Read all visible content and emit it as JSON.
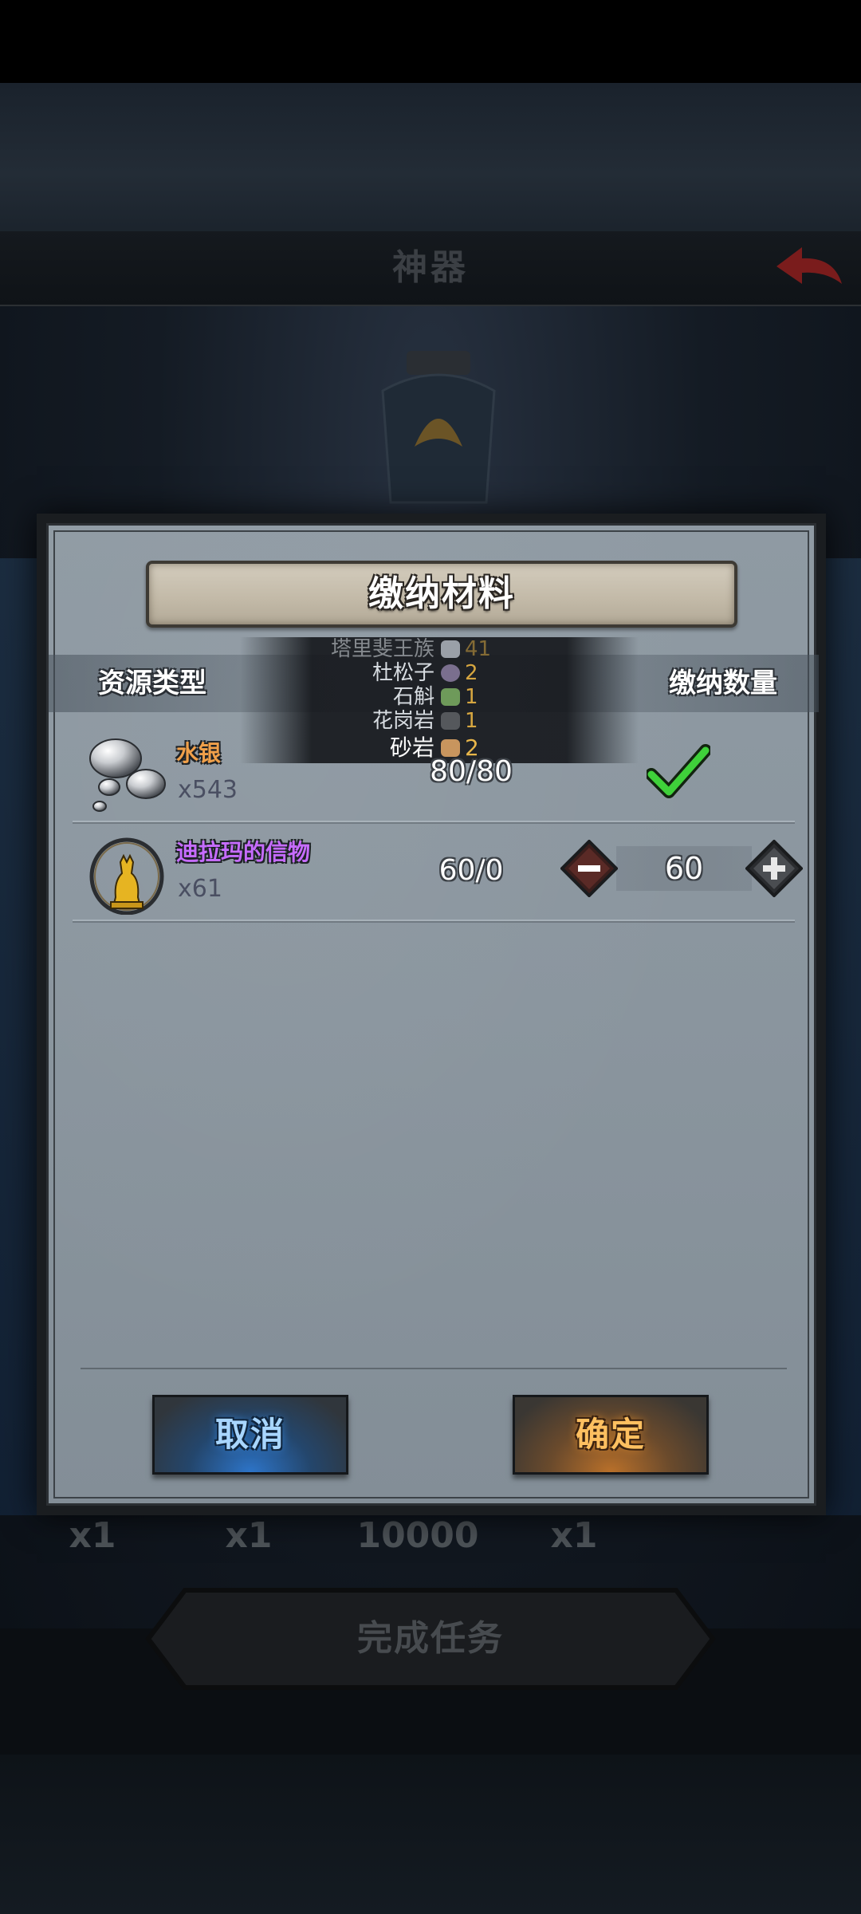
{
  "background": {
    "header_title": "神器",
    "rewards": [
      "x1",
      "x1",
      "10000",
      "x1"
    ],
    "complete_task_label": "完成任务"
  },
  "dialog": {
    "title": "缴纳材料",
    "column_resource_type": "资源类型",
    "column_submit_amount": "缴纳数量",
    "tooltip_items": [
      {
        "name": "塔里斐王族",
        "count": "41",
        "icon": "flower-icon",
        "color": "#9aa0a8"
      },
      {
        "name": "杜松子",
        "count": "2",
        "icon": "berries-icon",
        "color": "#7a6f8e"
      },
      {
        "name": "石斛",
        "count": "1",
        "icon": "herb-icon",
        "color": "#6e9a5a"
      },
      {
        "name": "花岗岩",
        "count": "1",
        "icon": "stone-icon",
        "color": "#55585c"
      },
      {
        "name": "砂岩",
        "count": "2",
        "icon": "sandstone-icon",
        "color": "#c8955e"
      }
    ],
    "materials": [
      {
        "name": "水银",
        "owned": "x543",
        "progress": "80/80",
        "icon": "mercury-icon",
        "status": "complete"
      },
      {
        "name": "迪拉玛的信物",
        "owned": "x61",
        "progress": "60/0",
        "icon": "golden-cat-statue-icon",
        "amount": "60"
      }
    ],
    "cancel_label": "取消",
    "confirm_label": "确定"
  },
  "colors": {
    "accent_orange": "#f0a04a",
    "accent_purple": "#c66cff",
    "check_green": "#3fd13a",
    "cancel_blue": "#2d74c8",
    "confirm_orange": "#b9702a"
  }
}
